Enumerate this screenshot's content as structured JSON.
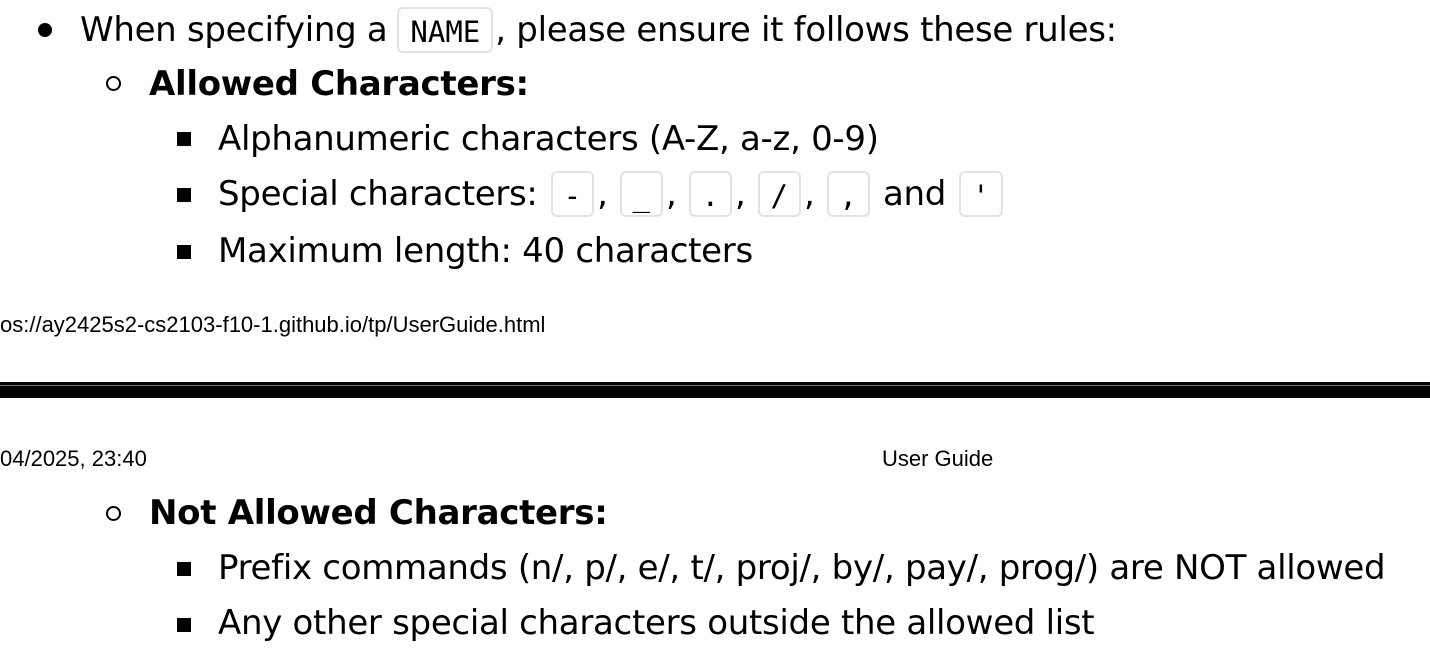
{
  "page1": {
    "name_rule": {
      "before": "When specifying a",
      "code": "NAME",
      "after": ", please ensure it follows these rules:"
    },
    "allowed": {
      "heading": "Allowed Characters:",
      "alphanumeric": "Alphanumeric characters (A-Z, a-z, 0-9)",
      "special": {
        "label": "Special characters:",
        "chars": [
          "-",
          "_",
          ".",
          "/",
          ","
        ],
        "separator": ",",
        "and": "and",
        "last": "'"
      },
      "max_length": "Maximum length: 40 characters"
    },
    "footer_url": "os://ay2425s2-cs2103-f10-1.github.io/tp/UserGuide.html"
  },
  "page2": {
    "header_date": "04/2025, 23:40",
    "header_title": "User Guide",
    "not_allowed": {
      "heading": "Not Allowed Characters:",
      "prefix": "Prefix commands (n/, p/, e/, t/, proj/, by/, pay/, prog/) are NOT allowed",
      "other": "Any other special characters outside the allowed list"
    }
  }
}
